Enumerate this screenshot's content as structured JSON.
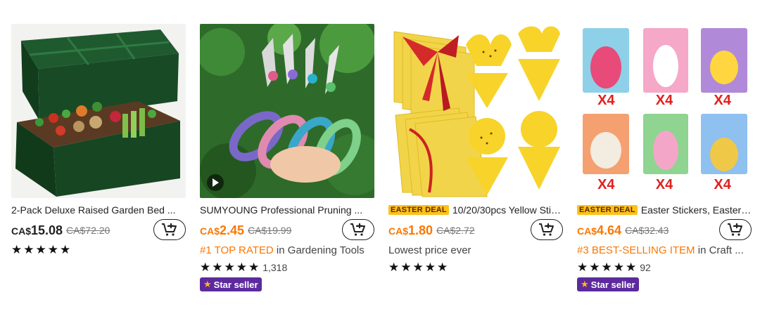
{
  "products": [
    {
      "title": "2-Pack Deluxe Raised Garden Bed ...",
      "deal": "",
      "price_currency": "CA$",
      "price_value": "15.08",
      "was_price": "CA$72.20",
      "tag_highlight": "",
      "tag_rest": "",
      "stars": "★★★★★",
      "rating_count": "",
      "star_seller": ""
    },
    {
      "title": "SUMYOUNG Professional Pruning ...",
      "deal": "",
      "price_currency": "CA$",
      "price_value": "2.45",
      "was_price": "CA$19.99",
      "tag_highlight": "#1 TOP RATED",
      "tag_rest": " in Gardening Tools",
      "stars": "★★★★★",
      "rating_count": "1,318",
      "star_seller": "Star seller"
    },
    {
      "title": "10/20/30pcs Yellow Stic...",
      "deal": "EASTER DEAL",
      "price_currency": "CA$",
      "price_value": "1.80",
      "was_price": "CA$2.72",
      "tag_highlight": "",
      "tag_rest": "Lowest price ever",
      "stars": "★★★★★",
      "rating_count": "",
      "star_seller": ""
    },
    {
      "title": "Easter Stickers, Easter B...",
      "deal": "EASTER DEAL",
      "price_currency": "CA$",
      "price_value": "4.64",
      "was_price": "CA$32.43",
      "tag_highlight": "#3 BEST-SELLING ITEM",
      "tag_rest": " in Craft ...",
      "stars": "★★★★★",
      "rating_count": "92",
      "star_seller": "Star seller"
    }
  ],
  "sticker_quantity_label": "X4",
  "colors": {
    "accent": "#fb7701",
    "star_seller_bg": "#5c2a9d",
    "deal_bg": "#ffc01a"
  }
}
